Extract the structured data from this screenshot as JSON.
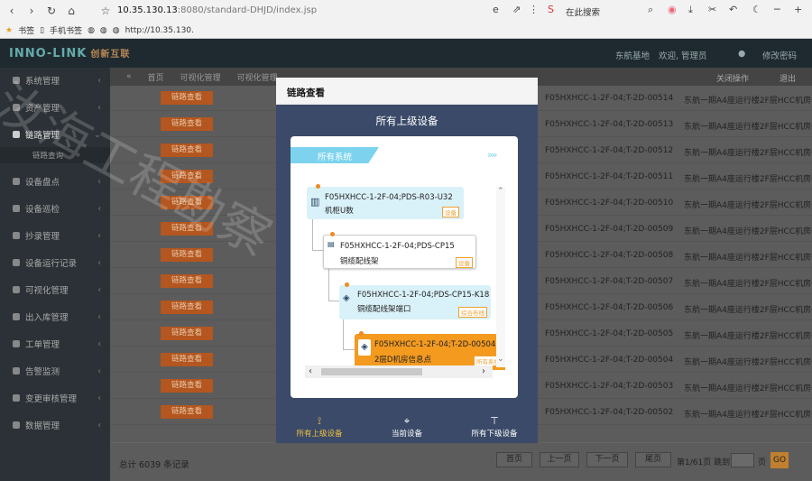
{
  "browser": {
    "url_host": "10.35.130.13",
    "url_path": ":8080/standard-DHJD/index.jsp",
    "search_hint": "在此搜索",
    "bookmarks_label": "书签",
    "mobile_bookmarks": "手机书签",
    "bookmark_url": "http://10.35.130."
  },
  "app": {
    "logo": "INNO-LINK",
    "logo_cn": "创新互联",
    "top_links": [
      "东航基地",
      "欢迎, 管理员",
      "修改密码"
    ],
    "sidebar": [
      {
        "label": "系统管理"
      },
      {
        "label": "资产管理"
      },
      {
        "label": "链路管理"
      },
      {
        "label": "设备盘点"
      },
      {
        "label": "设备巡检"
      },
      {
        "label": "抄录管理"
      },
      {
        "label": "设备运行记录"
      },
      {
        "label": "可视化管理"
      },
      {
        "label": "出入库管理"
      },
      {
        "label": "工单管理"
      },
      {
        "label": "告警监测"
      },
      {
        "label": "变更审核管理"
      },
      {
        "label": "数据管理"
      }
    ],
    "sidebar_sub": "链路查询",
    "tabs": [
      "首页",
      "可视化管理",
      "可视化管理"
    ],
    "tab_right": [
      "关闭操作",
      "退出"
    ],
    "row_button": "链路查看",
    "rows": [
      {
        "code": "F05HXHCC-1-2F-04;T-2D-00514",
        "loc": "东航一期A4座运行楼2F层HCC机房04"
      },
      {
        "code": "F05HXHCC-1-2F-04;T-2D-00513",
        "loc": "东航一期A4座运行楼2F层HCC机房04"
      },
      {
        "code": "F05HXHCC-1-2F-04;T-2D-00512",
        "loc": "东航一期A4座运行楼2F层HCC机房04"
      },
      {
        "code": "F05HXHCC-1-2F-04;T-2D-00511",
        "loc": "东航一期A4座运行楼2F层HCC机房04"
      },
      {
        "code": "F05HXHCC-1-2F-04;T-2D-00510",
        "loc": "东航一期A4座运行楼2F层HCC机房04"
      },
      {
        "code": "F05HXHCC-1-2F-04;T-2D-00509",
        "loc": "东航一期A4座运行楼2F层HCC机房04"
      },
      {
        "code": "F05HXHCC-1-2F-04;T-2D-00508",
        "loc": "东航一期A4座运行楼2F层HCC机房04"
      },
      {
        "code": "F05HXHCC-1-2F-04;T-2D-00507",
        "loc": "东航一期A4座运行楼2F层HCC机房04"
      },
      {
        "code": "F05HXHCC-1-2F-04;T-2D-00506",
        "loc": "东航一期A4座运行楼2F层HCC机房04"
      },
      {
        "code": "F05HXHCC-1-2F-04;T-2D-00505",
        "loc": "东航一期A4座运行楼2F层HCC机房04"
      },
      {
        "code": "F05HXHCC-1-2F-04;T-2D-00504",
        "loc": "东航一期A4座运行楼2F层HCC机房04"
      },
      {
        "code": "F05HXHCC-1-2F-04;T-2D-00503",
        "loc": "东航一期A4座运行楼2F层HCC机房04"
      },
      {
        "code": "F05HXHCC-1-2F-04;T-2D-00502",
        "loc": "东航一期A4座运行楼2F层HCC机房04"
      }
    ],
    "footer": {
      "total": "总计 6039 条记录",
      "first": "首页",
      "prev": "上一页",
      "next": "下一页",
      "last": "尾页",
      "page_info": "第1/61页 跳到",
      "page_suffix": "页",
      "go": "GO"
    }
  },
  "modal": {
    "title": "链路查看",
    "heading": "所有上级设备",
    "ribbon": "所有系统",
    "nodes": [
      {
        "line1": "F05HXHCC-1-2F-04;PDS-R03-U32",
        "line2": "机柜U数",
        "tag": "设备"
      },
      {
        "line1": "F05HXHCC-1-2F-04;PDS-CP15",
        "line2": "铜缆配线架",
        "tag": "设备"
      },
      {
        "line1": "F05HXHCC-1-2F-04;PDS-CP15-K18",
        "line2": "铜缆配线架端口",
        "tag": "综合布线"
      },
      {
        "line1": "F05HXHCC-1-2F-04;T-2D-00504",
        "line2": "2层D机房信息点",
        "tag": "所有系统"
      }
    ],
    "footer": [
      {
        "label": "所有上级设备",
        "icon": "tree-up-icon"
      },
      {
        "label": "当前设备",
        "icon": "crosshair-icon"
      },
      {
        "label": "所有下级设备",
        "icon": "tree-down-icon"
      }
    ]
  },
  "watermark": "汝海工程勘察"
}
